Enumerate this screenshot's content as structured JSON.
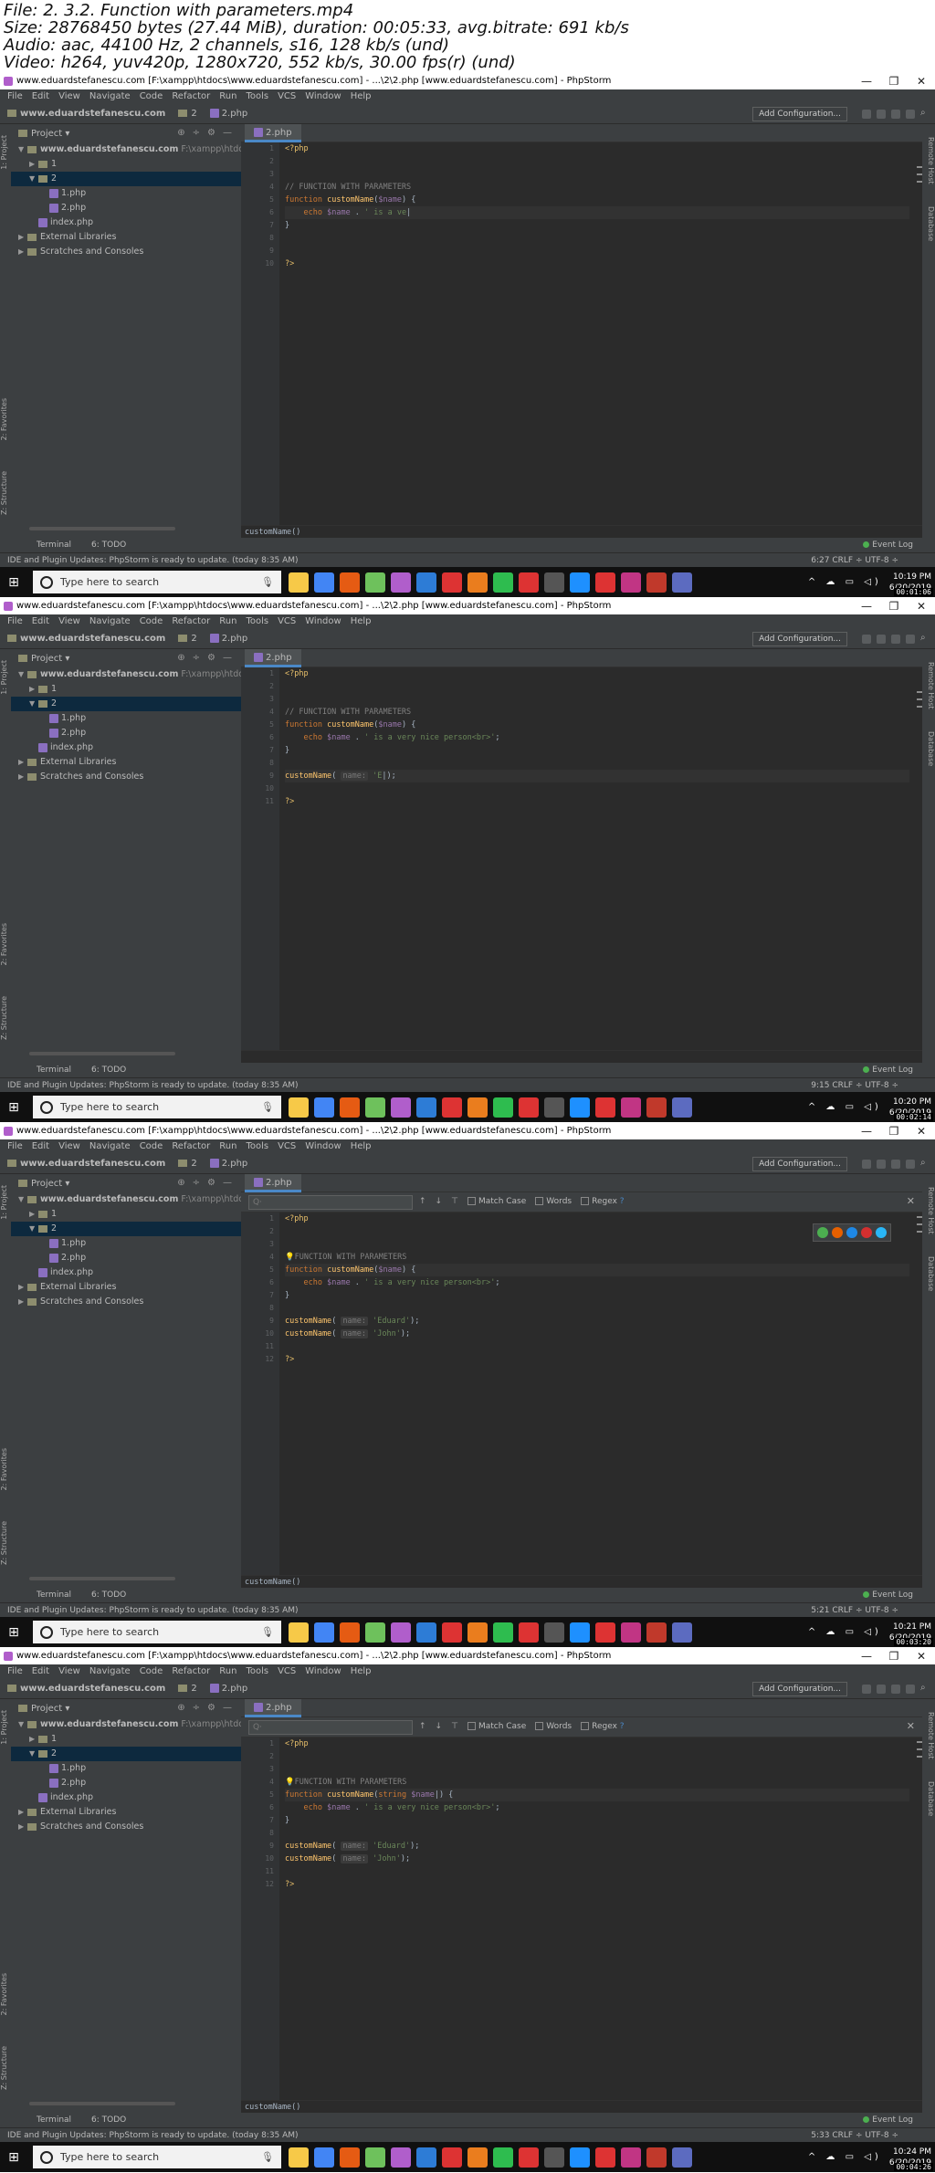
{
  "header": {
    "lines": [
      "File: 2. 3.2. Function with parameters.mp4",
      "Size: 28768450 bytes (27.44 MiB), duration: 00:05:33, avg.bitrate: 691 kb/s",
      "Audio: aac, 44100 Hz, 2 channels, s16, 128 kb/s (und)",
      "Video: h264, yuv420p, 1280x720, 552 kb/s, 30.00 fps(r) (und)"
    ]
  },
  "ide": {
    "window_title": "www.eduardstefanescu.com [F:\\xampp\\htdocs\\www.eduardstefanescu.com] - ...\\2\\2.php [www.eduardstefanescu.com] - PhpStorm",
    "window_buttons": [
      "—",
      "❐",
      "✕"
    ],
    "menu": [
      "File",
      "Edit",
      "View",
      "Navigate",
      "Code",
      "Refactor",
      "Run",
      "Tools",
      "VCS",
      "Window",
      "Help"
    ],
    "breadcrumbs": [
      "www.eduardstefanescu.com",
      "2",
      "2.php"
    ],
    "add_config": "Add Configuration...",
    "project_label": "Project",
    "tree": [
      {
        "label": "www.eduardstefanescu.com",
        "path": "F:\\xampp\\htdocs\\w",
        "indent": 0,
        "expanded": true,
        "folder": true,
        "bold": true
      },
      {
        "label": "1",
        "path": "",
        "indent": 1,
        "expanded": false,
        "folder": true
      },
      {
        "label": "2",
        "path": "",
        "indent": 1,
        "expanded": true,
        "folder": true,
        "selected": true
      },
      {
        "label": "1.php",
        "path": "",
        "indent": 2,
        "php": true
      },
      {
        "label": "2.php",
        "path": "",
        "indent": 2,
        "php": true
      },
      {
        "label": "index.php",
        "path": "",
        "indent": 1,
        "php": true
      },
      {
        "label": "External Libraries",
        "path": "",
        "indent": 0,
        "expanded": false,
        "lib": true
      },
      {
        "label": "Scratches and Consoles",
        "path": "",
        "indent": 0,
        "lib": true
      }
    ],
    "tab_label": "2.php",
    "left_tools": [
      "1: Project",
      "2: Favorites",
      "Z: Structure"
    ],
    "right_tools": [
      "Remote Host",
      "Database"
    ],
    "bottom_tools": [
      "Terminal",
      "6: TODO"
    ],
    "event_log": "Event Log",
    "status_msg": "IDE and Plugin Updates: PhpStorm is ready to update. (today 8:35 AM)",
    "find": {
      "placeholder": "Q·",
      "match_case": "Match Case",
      "words": "Words",
      "regex": "Regex",
      "help": "?"
    },
    "taskbar_search": "Type here to search"
  },
  "frames": [
    {
      "cursor": "6:27",
      "status_tail": "CRLF ÷  UTF-8 ÷",
      "time": "10:19 PM",
      "date": "6/20/2019",
      "timestamp": "00:01:06",
      "code_status": "customName()",
      "find_bar": false,
      "lines": [
        {
          "n": "1",
          "html": "<span class='t'>&lt;?php</span>"
        },
        {
          "n": "2",
          "html": ""
        },
        {
          "n": "3",
          "html": ""
        },
        {
          "n": "4",
          "html": "<span class='c'>// FUNCTION WITH PARAMETERS</span>"
        },
        {
          "n": "5",
          "html": "<span class='k'>function</span> <span class='fn'>customName</span>(<span class='v'>$name</span>) {"
        },
        {
          "n": "6",
          "html": "    <span class='k'>echo</span> <span class='v'>$name</span> . <span class='s'>' is a ve</span>|",
          "cur": true
        },
        {
          "n": "7",
          "html": "}"
        },
        {
          "n": "8",
          "html": ""
        },
        {
          "n": "9",
          "html": ""
        },
        {
          "n": "10",
          "html": "<span class='t'>?&gt;</span>"
        }
      ]
    },
    {
      "cursor": "9:15",
      "status_tail": "CRLF ÷  UTF-8 ÷",
      "time": "10:20 PM",
      "date": "6/20/2019",
      "timestamp": "00:02:14",
      "code_status": "",
      "find_bar": false,
      "lines": [
        {
          "n": "1",
          "html": "<span class='t'>&lt;?php</span>"
        },
        {
          "n": "2",
          "html": ""
        },
        {
          "n": "3",
          "html": ""
        },
        {
          "n": "4",
          "html": "<span class='c'>// FUNCTION WITH PARAMETERS</span>"
        },
        {
          "n": "5",
          "html": "<span class='k'>function</span> <span class='fn'>customName</span>(<span class='v'>$name</span>) {"
        },
        {
          "n": "6",
          "html": "    <span class='k'>echo</span> <span class='v'>$name</span> . <span class='s'>' is a very nice person&lt;br&gt;'</span>;"
        },
        {
          "n": "7",
          "html": "}"
        },
        {
          "n": "8",
          "html": ""
        },
        {
          "n": "9",
          "html": "<span class='fn'>customName</span>( <span class='hint'>name:</span> <span class='s'>'E</span>|);",
          "cur": true
        },
        {
          "n": "10",
          "html": ""
        },
        {
          "n": "11",
          "html": "<span class='t'>?&gt;</span>"
        }
      ]
    },
    {
      "cursor": "5:21",
      "status_tail": "CRLF ÷  UTF-8 ÷",
      "time": "10:21 PM",
      "date": "6/20/2019",
      "timestamp": "00:03:20",
      "code_status": "customName()",
      "find_bar": true,
      "browsers": true,
      "lines": [
        {
          "n": "1",
          "html": "<span class='t'>&lt;?php</span>"
        },
        {
          "n": "2",
          "html": ""
        },
        {
          "n": "3",
          "html": ""
        },
        {
          "n": "4",
          "html": "<span class='bulb'>💡</span><span class='c'>FUNCTION WITH PARAMETERS</span>"
        },
        {
          "n": "5",
          "html": "<span class='k'>function</span> <span class='fn'>customName</span>(<span class='v'>$name</span>) {",
          "cur": true
        },
        {
          "n": "6",
          "html": "    <span class='k'>echo</span> <span class='v'>$name</span> . <span class='s'>' is a very nice person&lt;br&gt;'</span>;"
        },
        {
          "n": "7",
          "html": "}"
        },
        {
          "n": "8",
          "html": ""
        },
        {
          "n": "9",
          "html": "<span class='fn'>customName</span>( <span class='hint'>name:</span> <span class='s'>'Eduard'</span>);"
        },
        {
          "n": "10",
          "html": "<span class='fn'>customName</span>( <span class='hint'>name:</span> <span class='s'>'John'</span>);"
        },
        {
          "n": "11",
          "html": ""
        },
        {
          "n": "12",
          "html": "<span class='t'>?&gt;</span>"
        }
      ]
    },
    {
      "cursor": "5:33",
      "status_tail": "CRLF ÷  UTF-8 ÷",
      "time": "10:24 PM",
      "date": "6/20/2019",
      "timestamp": "00:04:26",
      "code_status": "customName()",
      "find_bar": true,
      "lines": [
        {
          "n": "1",
          "html": "<span class='t'>&lt;?php</span>"
        },
        {
          "n": "2",
          "html": ""
        },
        {
          "n": "3",
          "html": ""
        },
        {
          "n": "4",
          "html": "<span class='bulb'>💡</span><span class='c'>FUNCTION WITH PARAMETERS</span>"
        },
        {
          "n": "5",
          "html": "<span class='k'>function</span> <span class='fn'>customName</span>(<span class='k'>string</span> <span class='v'>$name</span>|) {",
          "cur": true
        },
        {
          "n": "6",
          "html": "    <span class='k'>echo</span> <span class='v'>$name</span> . <span class='s'>' is a very nice person&lt;br&gt;'</span>;"
        },
        {
          "n": "7",
          "html": "}"
        },
        {
          "n": "8",
          "html": ""
        },
        {
          "n": "9",
          "html": "<span class='fn'>customName</span>( <span class='hint'>name:</span> <span class='s'>'Eduard'</span>);"
        },
        {
          "n": "10",
          "html": "<span class='fn'>customName</span>( <span class='hint'>name:</span> <span class='s'>'John'</span>);"
        },
        {
          "n": "11",
          "html": ""
        },
        {
          "n": "12",
          "html": "<span class='t'>?&gt;</span>"
        }
      ]
    }
  ],
  "colors": {
    "taskbar_icons": [
      "#f7c948",
      "#4285f4",
      "#e55b13",
      "#6ec15c",
      "#b05ecb",
      "#2d7cd6",
      "#d33",
      "#ea7d1e",
      "#2ebc4f",
      "#d33",
      "#555",
      "#1e90ff",
      "#d33",
      "#c13584",
      "#c0392b",
      "#5c6bc0"
    ]
  }
}
